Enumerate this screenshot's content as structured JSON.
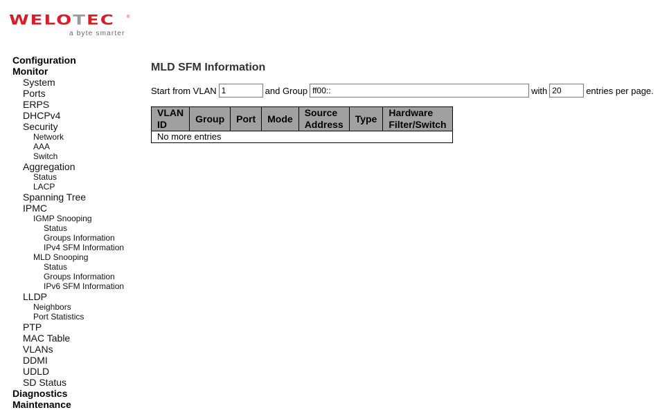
{
  "brand": {
    "name_a": "WELO",
    "name_b": "T",
    "name_c": "EC",
    "registered": "®",
    "tagline": "a byte smarter",
    "colors": {
      "primary": "#d81e2a",
      "secondary": "#9a9a9a"
    }
  },
  "nav": [
    {
      "label": "Configuration",
      "level": 0
    },
    {
      "label": "Monitor",
      "level": 0
    },
    {
      "label": "System",
      "level": 1
    },
    {
      "label": "Ports",
      "level": 1
    },
    {
      "label": "ERPS",
      "level": 1
    },
    {
      "label": "DHCPv4",
      "level": 1
    },
    {
      "label": "Security",
      "level": 1
    },
    {
      "label": "Network",
      "level": 2
    },
    {
      "label": "AAA",
      "level": 2
    },
    {
      "label": "Switch",
      "level": 2
    },
    {
      "label": "Aggregation",
      "level": 1
    },
    {
      "label": "Status",
      "level": 2
    },
    {
      "label": "LACP",
      "level": 2
    },
    {
      "label": "Spanning Tree",
      "level": 1
    },
    {
      "label": "IPMC",
      "level": 1
    },
    {
      "label": "IGMP Snooping",
      "level": 2
    },
    {
      "label": "Status",
      "level": 3
    },
    {
      "label": "Groups Information",
      "level": 3
    },
    {
      "label": "IPv4 SFM Information",
      "level": 3
    },
    {
      "label": "MLD Snooping",
      "level": 2
    },
    {
      "label": "Status",
      "level": 3
    },
    {
      "label": "Groups Information",
      "level": 3
    },
    {
      "label": "IPv6 SFM Information",
      "level": 3
    },
    {
      "label": "LLDP",
      "level": 1
    },
    {
      "label": "Neighbors",
      "level": 2
    },
    {
      "label": "Port Statistics",
      "level": 2
    },
    {
      "label": "PTP",
      "level": 1
    },
    {
      "label": "MAC Table",
      "level": 1
    },
    {
      "label": "VLANs",
      "level": 1
    },
    {
      "label": "DDMI",
      "level": 1
    },
    {
      "label": "UDLD",
      "level": 1
    },
    {
      "label": "SD Status",
      "level": 1
    },
    {
      "label": "Diagnostics",
      "level": 0
    },
    {
      "label": "Maintenance",
      "level": 0
    }
  ],
  "page": {
    "title": "MLD SFM Information",
    "filter": {
      "start_label": "Start from VLAN",
      "vlan_value": "1",
      "group_label": "and Group",
      "group_value": "ff00::",
      "with_label": "with",
      "entries_value": "20",
      "entries_suffix": "entries per page."
    },
    "table": {
      "columns": [
        "VLAN ID",
        "Group",
        "Port",
        "Mode",
        "Source Address",
        "Type",
        "Hardware Filter/Switch"
      ],
      "empty_message": "No more entries"
    }
  }
}
